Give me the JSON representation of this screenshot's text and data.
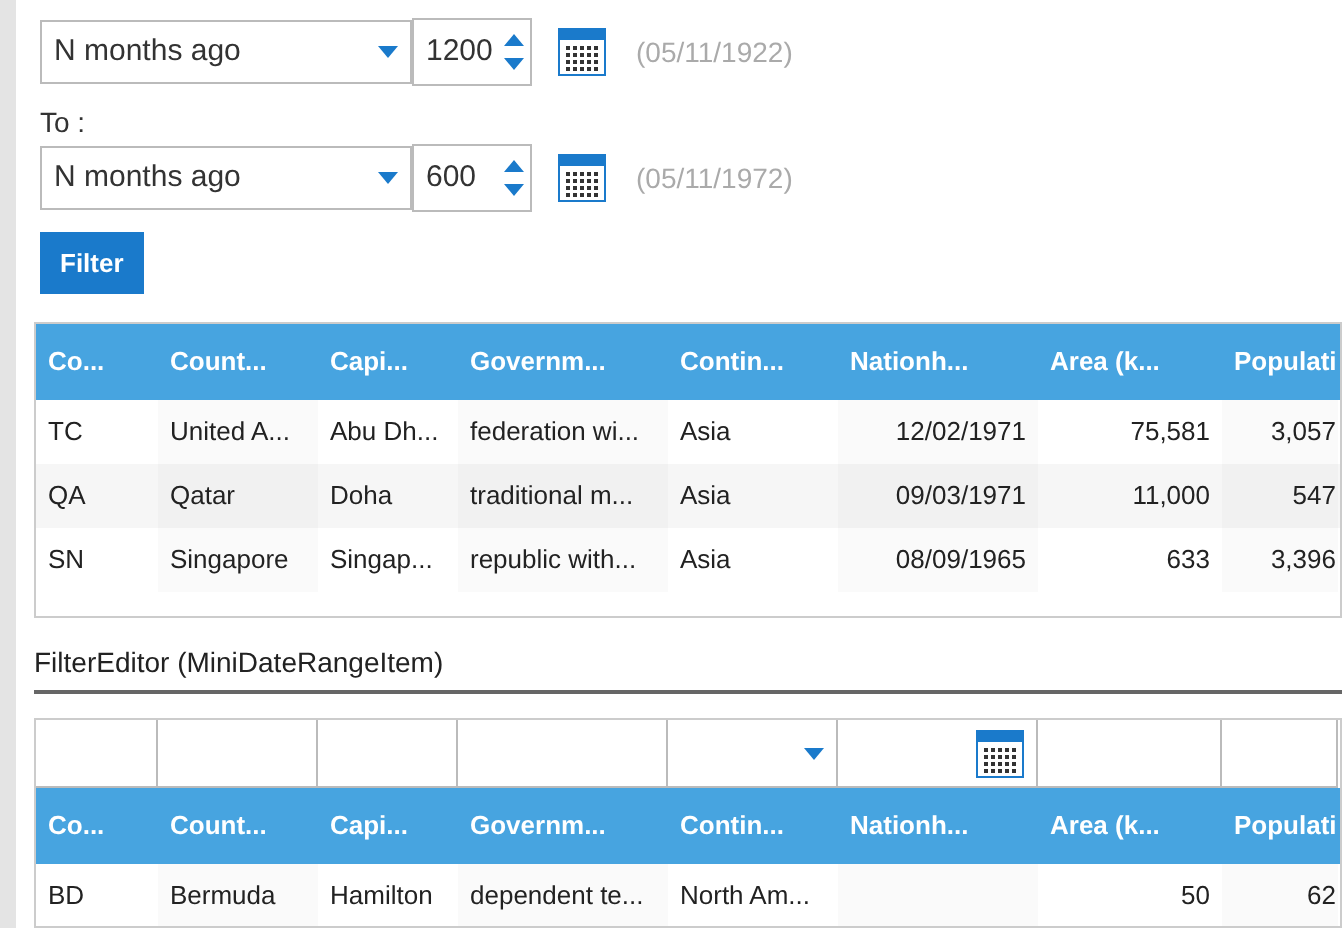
{
  "range": [
    {
      "mode": "N months ago",
      "amount": "1200",
      "date": "(05/11/1922)"
    },
    {
      "label": "To :",
      "mode": "N months ago",
      "amount": "600",
      "date": "(05/11/1972)"
    }
  ],
  "filter_button": "Filter",
  "columns": [
    {
      "title": "Co...",
      "numeric": false
    },
    {
      "title": "Count...",
      "numeric": false
    },
    {
      "title": "Capi...",
      "numeric": false
    },
    {
      "title": "Governm...",
      "numeric": false
    },
    {
      "title": "Contin...",
      "numeric": false
    },
    {
      "title": "Nationh...",
      "numeric": true
    },
    {
      "title": "Area (k...",
      "numeric": true
    },
    {
      "title": "Populati",
      "numeric": true
    }
  ],
  "grid_rows": [
    [
      "TC",
      "United A...",
      "Abu Dh...",
      "federation wi...",
      "Asia",
      "12/02/1971",
      "75,581",
      "3,057"
    ],
    [
      "QA",
      "Qatar",
      "Doha",
      "traditional m...",
      "Asia",
      "09/03/1971",
      "11,000",
      "547"
    ],
    [
      "SN",
      "Singapore",
      "Singap...",
      "republic with...",
      "Asia",
      "08/09/1965",
      "633",
      "3,396"
    ]
  ],
  "section_title": "FilterEditor (MiniDateRangeItem)",
  "filter_row": [
    {
      "kind": "text"
    },
    {
      "kind": "text"
    },
    {
      "kind": "text"
    },
    {
      "kind": "text"
    },
    {
      "kind": "select"
    },
    {
      "kind": "date"
    },
    {
      "kind": "text"
    },
    {
      "kind": "text"
    }
  ],
  "editor_columns": [
    {
      "title": "Co...",
      "numeric": false
    },
    {
      "title": "Count...",
      "numeric": false
    },
    {
      "title": "Capi...",
      "numeric": false
    },
    {
      "title": "Governm...",
      "numeric": false
    },
    {
      "title": "Contin...",
      "numeric": false
    },
    {
      "title": "Nationh..."
    },
    {
      "title": "Area (k...",
      "numeric": true
    },
    {
      "title": "Populati",
      "numeric": true
    }
  ],
  "editor_rows": [
    [
      "BD",
      "Bermuda",
      "Hamilton",
      "dependent te...",
      "North Am...",
      null,
      "50",
      "62"
    ]
  ]
}
